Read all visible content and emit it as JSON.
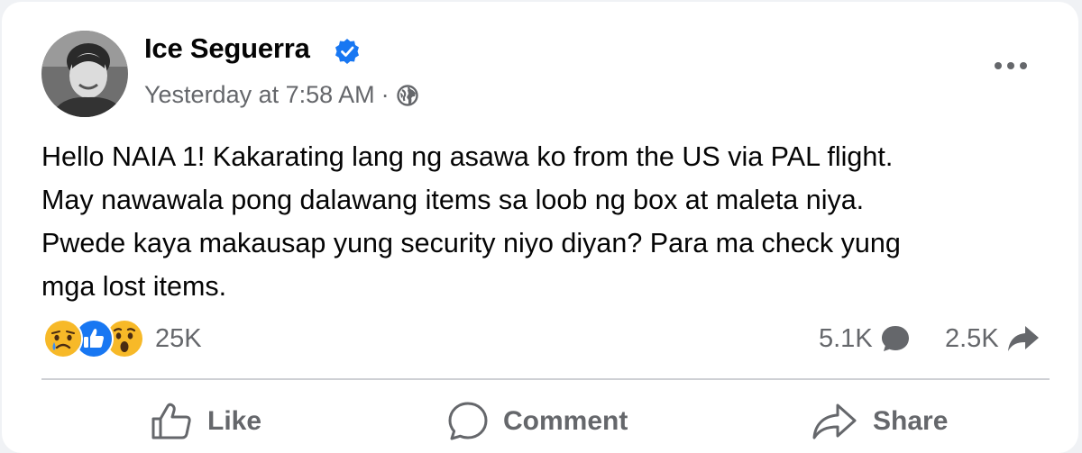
{
  "post": {
    "author": "Ice Seguerra",
    "timestamp": "Yesterday at 7:58 AM",
    "separator": "·",
    "privacy_icon": "globe-icon",
    "verified_icon": "verified-badge-icon",
    "body": "Hello NAIA 1! Kakarating lang ng asawa ko from the US via PAL flight.\nMay nawawala pong dalawang items sa loob ng box at maleta niya.\nPwede kaya makausap yung security niyo diyan? Para ma check yung\nmga lost items.",
    "reactions": {
      "icons": [
        "sad-reaction-icon",
        "like-reaction-icon",
        "wow-reaction-icon"
      ],
      "count": "25K"
    },
    "comments_count": "5.1K",
    "shares_count": "2.5K"
  },
  "actions": {
    "like": "Like",
    "comment": "Comment",
    "share": "Share"
  },
  "colors": {
    "card": "#ffffff",
    "background": "#f0f2f5",
    "secondary_text": "#65676b",
    "verified_blue": "#1877f2",
    "divider": "#ced0d4"
  }
}
